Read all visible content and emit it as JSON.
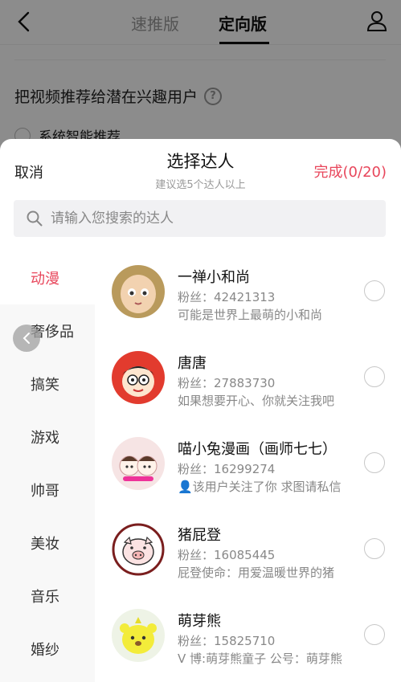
{
  "header": {
    "tabs": [
      {
        "label": "速推版",
        "active": false
      },
      {
        "label": "定向版",
        "active": true
      }
    ],
    "back_icon": "chevron-left-icon",
    "user_icon": "user-icon"
  },
  "background": {
    "question": "把视频推荐给潜在兴趣用户",
    "help_icon_glyph": "?",
    "option_label": "系统智能推荐"
  },
  "sheet": {
    "cancel_label": "取消",
    "title": "选择达人",
    "subtitle": "建议选5个达人以上",
    "done_label": "完成(0/20)",
    "accent_color": "#e8465b"
  },
  "search": {
    "placeholder": "请输入您搜索的达人",
    "value": ""
  },
  "categories": [
    {
      "label": "动漫",
      "active": true
    },
    {
      "label": "奢侈品",
      "active": false
    },
    {
      "label": "搞笑",
      "active": false
    },
    {
      "label": "游戏",
      "active": false
    },
    {
      "label": "帅哥",
      "active": false
    },
    {
      "label": "美妆",
      "active": false
    },
    {
      "label": "音乐",
      "active": false
    },
    {
      "label": "婚纱",
      "active": false
    }
  ],
  "influencers": [
    {
      "name": "一禅小和尚",
      "fans": "粉丝：42421313",
      "desc": "可能是世界上最萌的小和尚",
      "selected": false
    },
    {
      "name": "唐唐",
      "fans": "粉丝：27883730",
      "desc": "如果想要开心、你就关注我吧",
      "selected": false
    },
    {
      "name": "喵小兔漫画（画师七七）",
      "fans": "粉丝：16299274",
      "desc": "👤该用户关注了你 求图请私信",
      "selected": false
    },
    {
      "name": "猪屁登",
      "fans": "粉丝：16085445",
      "desc": "屁登使命：用爱温暖世界的猪",
      "selected": false
    },
    {
      "name": "萌芽熊",
      "fans": "粉丝：15825710",
      "desc": "V 博:萌芽熊童子 公号：萌芽熊",
      "selected": false
    }
  ]
}
